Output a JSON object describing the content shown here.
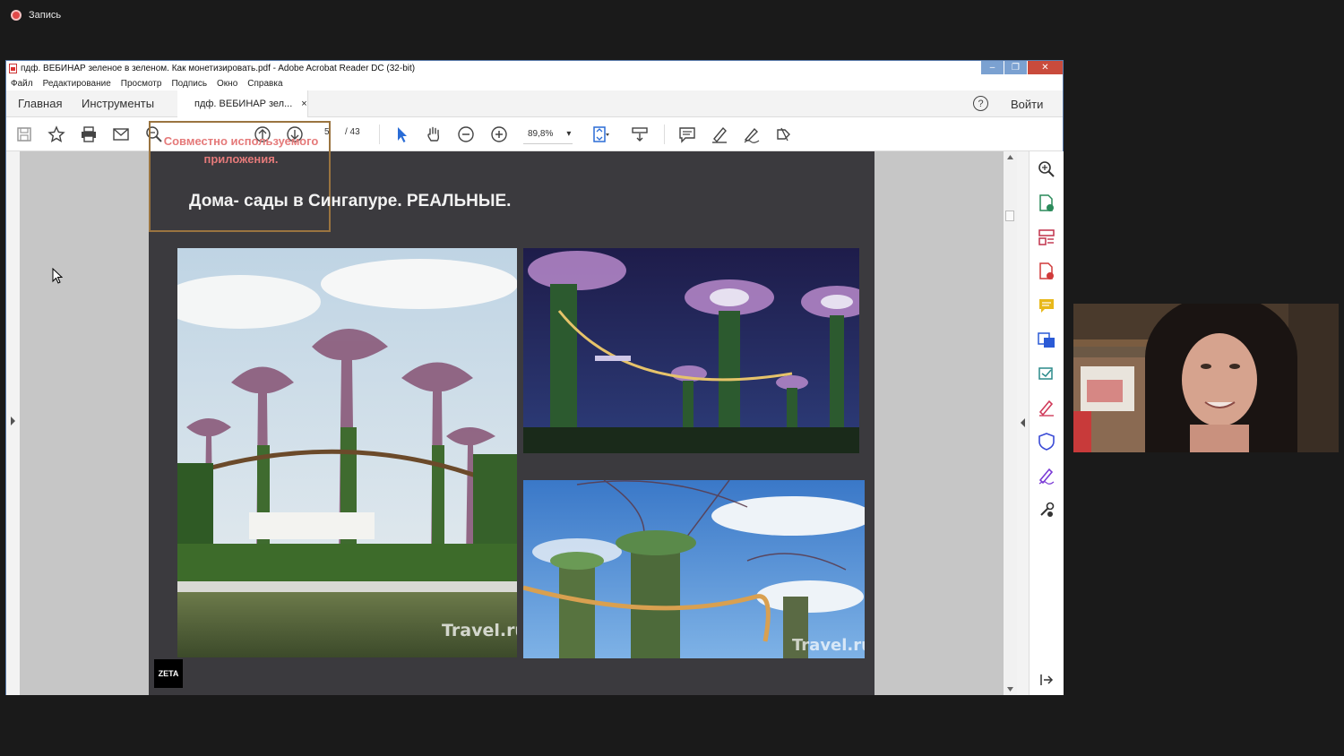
{
  "recording": {
    "label": "Запись"
  },
  "window": {
    "title": "пдф. ВЕБИНАР зеленое в зеленом. Как монетизировать.pdf - Adobe Acrobat Reader DC (32-bit)",
    "controls": {
      "minimize": "–",
      "maximize": "❐",
      "close": "✕"
    }
  },
  "menu": [
    "Файл",
    "Редактирование",
    "Просмотр",
    "Подпись",
    "Окно",
    "Справка"
  ],
  "tabs": {
    "home": "Главная",
    "tools": "Инструменты",
    "document": "пдф. ВЕБИНАР зел...",
    "close": "×",
    "help": "?",
    "login": "Войти"
  },
  "toolbar": {
    "page_current": "5",
    "page_total": "/ 43",
    "zoom": "89,8%",
    "zoom_arrow": "▾"
  },
  "slide": {
    "title": "Дома- сады в Сингапуре. РЕАЛЬНЫЕ.",
    "overlay_line1": "Совместно используемого",
    "overlay_line2": "приложения.",
    "watermark_1": "Travel.ru",
    "watermark_3": "Travel.ru",
    "badge": "ZETA"
  },
  "colors": {
    "page_bg": "#3b3a3e",
    "overlay_text": "#e57a7a",
    "accent_blue": "#2a6cd6",
    "recording_red": "#e04848"
  },
  "icons": {
    "toolbar": [
      "save-icon",
      "bookmark-star-icon",
      "print-icon",
      "email-icon",
      "zoom-search-icon",
      "page-up-icon",
      "page-down-icon",
      "select-cursor-icon",
      "hand-icon",
      "zoom-out-icon",
      "zoom-in-icon",
      "fit-page-icon",
      "scroll-mode-icon",
      "comment-icon",
      "highlight-pen-icon",
      "sign-icon",
      "share-icon"
    ],
    "right_panel": [
      "search-tool-icon",
      "export-pdf-icon",
      "organize-pages-icon",
      "create-pdf-icon",
      "comment-tool-icon",
      "send-icon",
      "edit-pdf-icon",
      "fill-sign-icon",
      "protect-icon",
      "certificate-sign-icon",
      "more-tools-icon",
      "collapse-panel-icon"
    ]
  }
}
